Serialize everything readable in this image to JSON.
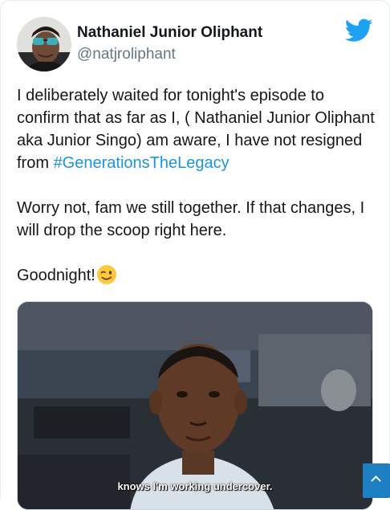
{
  "tweet": {
    "author_name": "Nathaniel Junior Oliphant",
    "author_handle": "@natjroliphant",
    "paragraph1_text": "I deliberately waited for tonight's episode to confirm that as far as I, ( Nathaniel Junior Oliphant aka Junior Singo) am aware, I have not resigned from ",
    "hashtag": "#GenerationsTheLegacy",
    "paragraph2": "Worry not, fam we still together. If that changes, I will drop the scoop right here.",
    "paragraph3": "Goodnight!",
    "media_subtitle": "knows I'm working undercover."
  },
  "icons": {
    "brand": "twitter-bird-icon",
    "emoji": "winking-face-emoji",
    "scroll": "chevron-up-icon"
  },
  "colors": {
    "brand_blue": "#1da1f2",
    "link_blue": "#1b95e0",
    "handle_gray": "#657786",
    "scroll_button": "#1d7fc1"
  }
}
